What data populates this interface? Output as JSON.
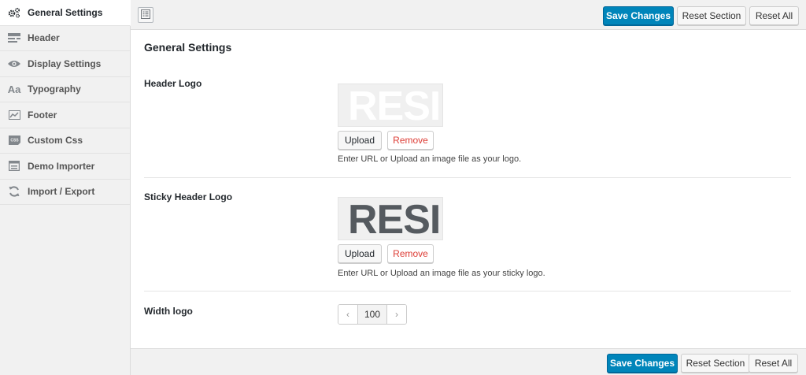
{
  "sidebar": {
    "items": [
      {
        "label": "General Settings",
        "icon": "gears-icon",
        "active": true
      },
      {
        "label": "Header",
        "icon": "header-icon"
      },
      {
        "label": "Display Settings",
        "icon": "eye-icon"
      },
      {
        "label": "Typography",
        "icon": "typography-icon"
      },
      {
        "label": "Footer",
        "icon": "chart-icon"
      },
      {
        "label": "Custom Css",
        "icon": "css-icon"
      },
      {
        "label": "Demo Importer",
        "icon": "importer-icon"
      },
      {
        "label": "Import / Export",
        "icon": "refresh-icon"
      }
    ]
  },
  "toolbar": {
    "save_label": "Save Changes",
    "reset_section_label": "Reset Section",
    "reset_all_label": "Reset All"
  },
  "main": {
    "section_title": "General Settings",
    "header_logo": {
      "label": "Header Logo",
      "preview_text": "RESI",
      "upload_label": "Upload",
      "remove_label": "Remove",
      "description": "Enter URL or Upload an image file as your logo."
    },
    "sticky_logo": {
      "label": "Sticky Header Logo",
      "preview_text": "RESI",
      "upload_label": "Upload",
      "remove_label": "Remove",
      "description": "Enter URL or Upload an image file as your sticky logo."
    },
    "width_logo": {
      "label": "Width logo",
      "value": "100"
    }
  },
  "colors": {
    "primary": "#0085ba",
    "remove": "#dd3d36"
  }
}
